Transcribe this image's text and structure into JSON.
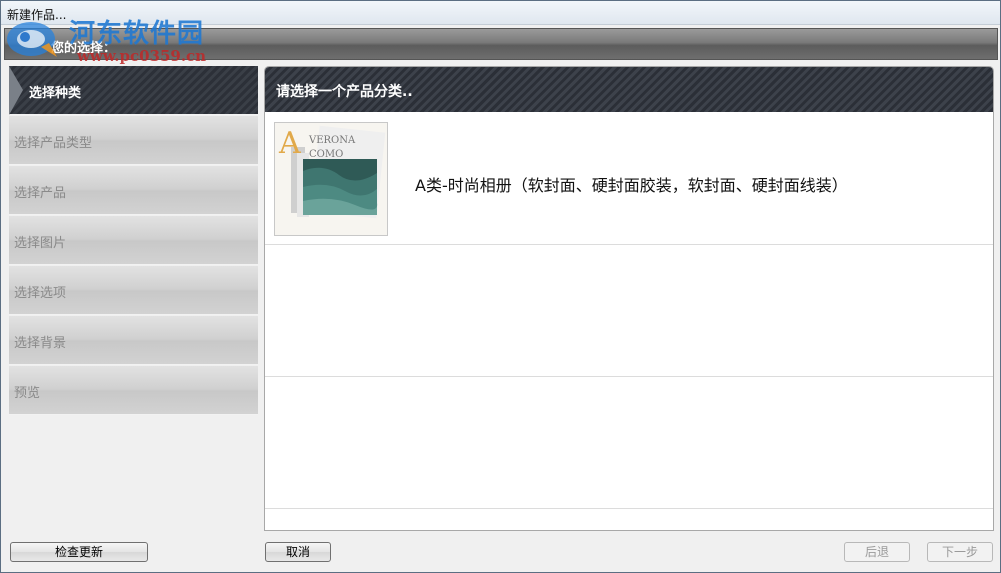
{
  "window": {
    "title": "新建作品..."
  },
  "watermark": {
    "name": "河东软件园",
    "url": "www.pc0359.cn"
  },
  "choice_bar": {
    "label": "您的选择："
  },
  "steps": [
    {
      "label": "选择种类",
      "active": true
    },
    {
      "label": "选择产品类型",
      "active": false
    },
    {
      "label": "选择产品",
      "active": false
    },
    {
      "label": "选择图片",
      "active": false
    },
    {
      "label": "选择选项",
      "active": false
    },
    {
      "label": "选择背景",
      "active": false
    },
    {
      "label": "预览",
      "active": false
    }
  ],
  "content": {
    "title": "请选择一个产品分类..",
    "categories": [
      {
        "label": "A类-时尚相册（软封面、硬封面胶装，软封面、硬封面线装）",
        "thumb_letter": "A",
        "thumb_text_1": "VERONA",
        "thumb_text_2": "COMO"
      }
    ]
  },
  "buttons": {
    "check_update": "检查更新",
    "cancel": "取消",
    "back": "后退",
    "next": "下一步"
  }
}
